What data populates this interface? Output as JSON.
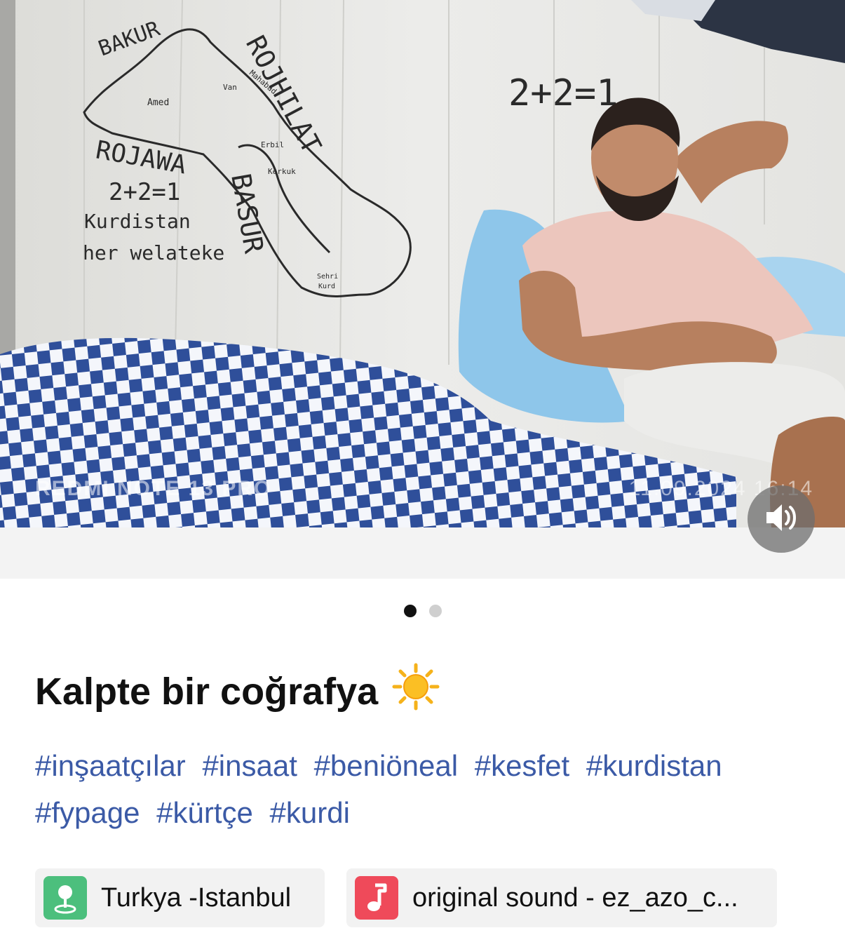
{
  "media": {
    "wall_writing": {
      "top": "BAKUR",
      "right": "ROJHILAT",
      "left": "ROJAWA",
      "center": "BASUR",
      "equation_left": "2+2=1",
      "equation_right": "2+2=1",
      "line1": "Kurdistan",
      "line2": "her welateke",
      "city_amed": "Amed",
      "city_van": "Van",
      "city_mahabad": "Mahabad",
      "city_erbil": "Erbil",
      "city_kerkuk": "Kerkuk",
      "city_sehri": "Sehri",
      "city_kurd": "Kurd"
    },
    "watermark_left": "REDMI NOTE 13 PRO",
    "watermark_right": "11.09.2024  16:14",
    "volume_icon": "speaker-volume-icon"
  },
  "pagination": {
    "count": 2,
    "active_index": 0
  },
  "post": {
    "title": "Kalpte bir coğrafya",
    "title_emoji": "☀️",
    "hashtags": [
      "#inşaatçılar",
      "#insaat",
      "#beniöneal",
      "#kesfet",
      "#kurdistan",
      "#fypage",
      "#kürtçe",
      "#kurdi"
    ]
  },
  "chips": {
    "location": {
      "label": "Turkya -Istanbul",
      "icon": "map-pin-icon",
      "color": "#4cbf7d"
    },
    "sound": {
      "label": "original sound - ez_azo_c...",
      "icon": "music-note-icon",
      "color": "#ef4a5a"
    }
  },
  "colors": {
    "hashtag": "#3b5aa6",
    "active_dot": "#111111",
    "inactive_dot": "#cfcfcf"
  }
}
